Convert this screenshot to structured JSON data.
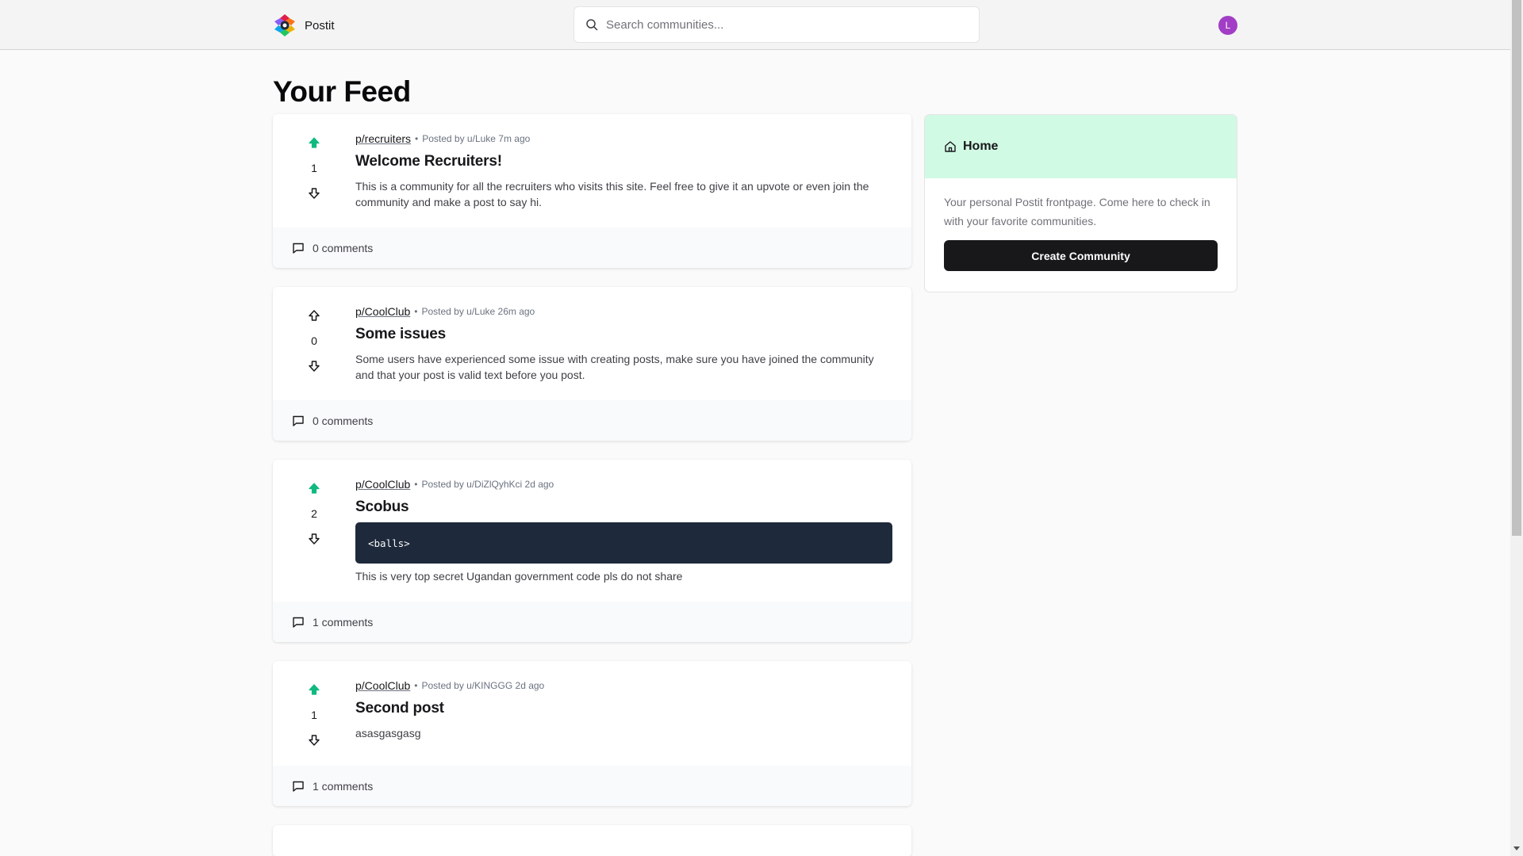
{
  "header": {
    "brand_name": "Postit",
    "search_placeholder": "Search communities...",
    "avatar_initial": "L",
    "avatar_color": "#a23ec5"
  },
  "page": {
    "title": "Your Feed"
  },
  "posts": [
    {
      "community": "p/recruiters",
      "posted_by": "Posted by u/Luke 7m ago",
      "title": "Welcome Recruiters!",
      "text": "This is a community for all the recruiters who visits this site. Feel free to give it an upvote or even join the community and make a post to say hi.",
      "votes": "1",
      "upvoted": true,
      "comments": "0 comments"
    },
    {
      "community": "p/CoolClub",
      "posted_by": "Posted by u/Luke 26m ago",
      "title": "Some issues",
      "text": "Some users have experienced some issue with creating posts, make sure you have joined the community and that your post is valid text before you post.",
      "votes": "0",
      "upvoted": false,
      "comments": "0 comments"
    },
    {
      "community": "p/CoolClub",
      "posted_by": "Posted by u/DiZlQyhKci 2d ago",
      "title": "Scobus",
      "code": "<balls>",
      "text": "This is very top secret Ugandan government code pls do not share",
      "votes": "2",
      "upvoted": true,
      "comments": "1 comments"
    },
    {
      "community": "p/CoolClub",
      "posted_by": "Posted by u/KINGGG 2d ago",
      "title": "Second post",
      "text": "asasgasgasg",
      "votes": "1",
      "upvoted": true,
      "comments": "1 comments"
    }
  ],
  "sidebar": {
    "title": "Home",
    "description": "Your personal Postit frontpage. Come here to check in with your favorite communities.",
    "create_button": "Create Community"
  },
  "colors": {
    "upvote_active": "#10b981",
    "sidebar_header": "#d1fae5",
    "code_bg": "#1e293b"
  },
  "icons": [
    "search-icon",
    "upvote-icon",
    "downvote-icon",
    "comment-icon",
    "home-icon",
    "postit-logo"
  ]
}
